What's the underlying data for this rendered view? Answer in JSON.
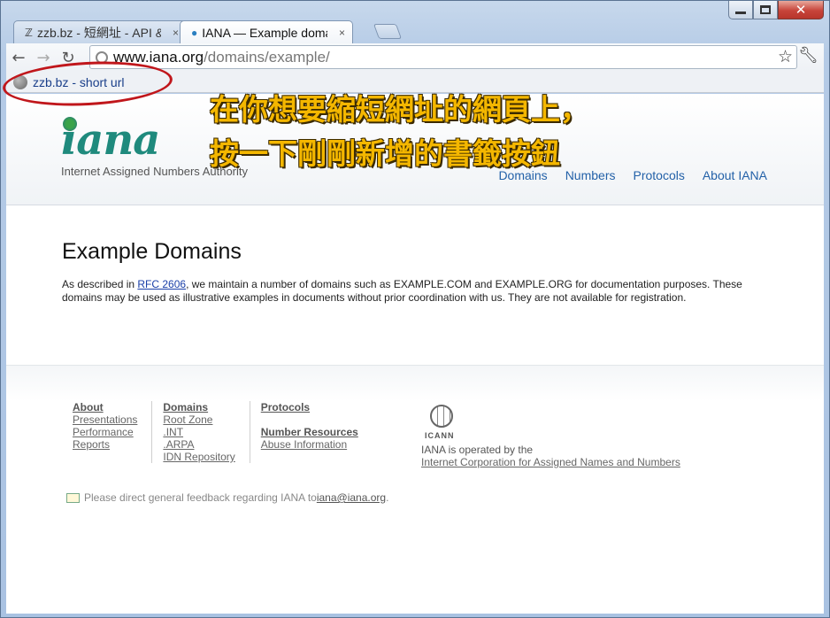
{
  "browser": {
    "tabs": [
      {
        "title": "zzb.bz - 短網址 - API & ...",
        "favicon": "zz-favicon"
      },
      {
        "title": "IANA — Example domains",
        "favicon": "iana-globe-favicon"
      }
    ],
    "close_glyph": "×",
    "url_host": "www.iana.org",
    "url_path": "/domains/example/",
    "bookmark": {
      "label": "zzb.bz - short url"
    }
  },
  "annotation": {
    "line1": "在你想要縮短網址的網頁上，",
    "line2": "按一下剛剛新增的書籤按鈕"
  },
  "page": {
    "logo_text": "iana",
    "logo_subtitle": "Internet Assigned Numbers Authority",
    "nav": [
      "Domains",
      "Numbers",
      "Protocols",
      "About IANA"
    ],
    "title": "Example Domains",
    "desc_before": "As described in ",
    "desc_link": "RFC 2606",
    "desc_after": ", we maintain a number of domains such as EXAMPLE.COM and EXAMPLE.ORG for documentation purposes. These domains may be used as illustrative examples in documents without prior coordination with us. They are not available for registration.",
    "footer": {
      "col1": {
        "head": "About",
        "links": [
          "Presentations",
          "Performance",
          "Reports"
        ]
      },
      "col2": {
        "head": "Domains",
        "links": [
          "Root Zone",
          ".INT",
          ".ARPA",
          "IDN Repository"
        ]
      },
      "col3": {
        "head": "Protocols",
        "head2": "Number Resources",
        "links": [
          "Abuse Information"
        ]
      },
      "icann_word": "ICANN",
      "icann_text": "IANA is operated by the",
      "icann_link": "Internet Corporation for Assigned Names and Numbers",
      "feedback_text": "Please direct general feedback regarding IANA to ",
      "feedback_email": "iana@iana.org",
      "feedback_end": "."
    }
  },
  "colors": {
    "annotation": "#f4b700",
    "highlight_circle": "#c0161b",
    "link": "#2361a8"
  }
}
